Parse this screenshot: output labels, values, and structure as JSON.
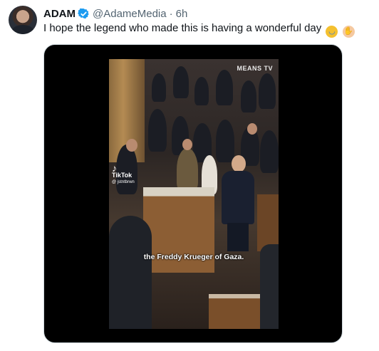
{
  "tweet": {
    "author_name": "ADAM",
    "handle": "@AdameMedia",
    "separator": "·",
    "time": "6h",
    "text": "I hope the legend who made this is having a wonderful day",
    "emojis": [
      "rolling-on-floor-laughing",
      "clapping-hands"
    ],
    "verified_color": "#1d9bf0"
  },
  "video": {
    "watermark": "MEANS TV",
    "tiktok_label": "TikTok",
    "tiktok_user": "@ jstntbrwn",
    "caption": "the Freddy Krueger of Gaza."
  }
}
